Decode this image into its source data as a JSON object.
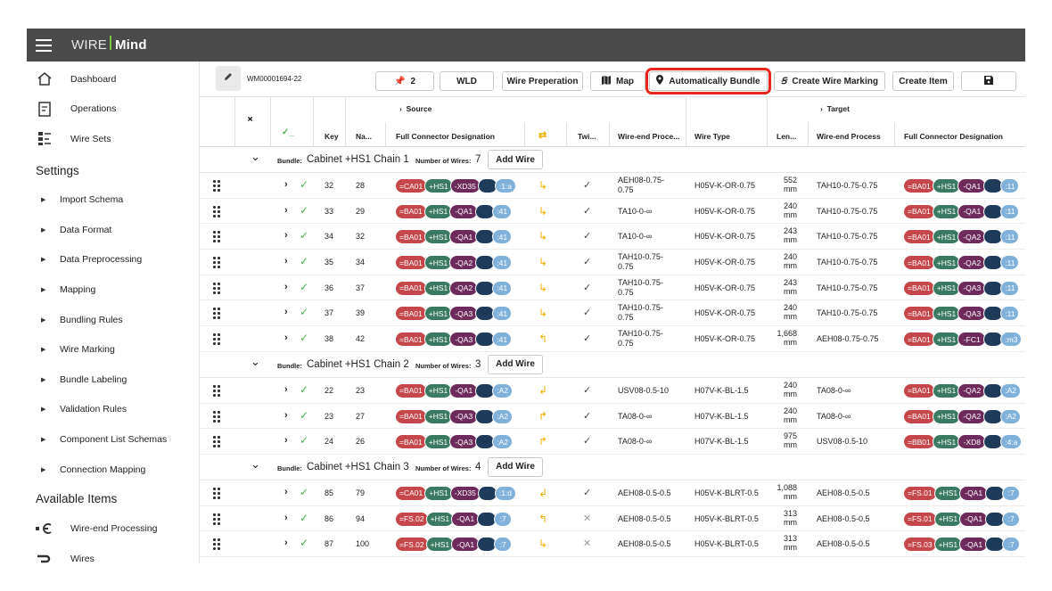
{
  "app": {
    "brand_part1": "WIRE",
    "brand_part2": "Mind"
  },
  "sidebar": {
    "main_items": [
      {
        "label": "Dashboard",
        "icon": "home-icon"
      },
      {
        "label": "Operations",
        "icon": "document-icon"
      },
      {
        "label": "Wire Sets",
        "icon": "wire-sets-icon"
      }
    ],
    "settings_title": "Settings",
    "settings_items": [
      "Import Schema",
      "Data Format",
      "Data Preprocessing",
      "Mapping",
      "Bundling Rules",
      "Wire Marking",
      "Bundle Labeling",
      "Validation Rules",
      "Component List Schemas",
      "Connection Mapping"
    ],
    "available_title": "Available Items",
    "available_items": [
      {
        "label": "Wire-end Processing",
        "icon": "wire-end-icon"
      },
      {
        "label": "Wires",
        "icon": "wire-icon"
      }
    ]
  },
  "toolbar": {
    "wire_marking_id": "WM00001694-22",
    "pin_count": "2",
    "wld": "WLD",
    "wire_prep": "Wire Preperation",
    "map": "Map",
    "auto_bundle": "Automatically Bundle",
    "create_marking": "Create Wire Marking",
    "create_item": "Create Item"
  },
  "table": {
    "source_label": "Source",
    "target_label": "Target",
    "headers": {
      "check": "✓_",
      "key": "Key",
      "name": "Na...",
      "src_connector": "Full Connector Designation",
      "twist": "Twi...",
      "src_process": "Wire-end Proce...",
      "wire_type": "Wire Type",
      "length": "Len...",
      "tgt_process": "Wire-end Process",
      "tgt_connector": "Full Connector Designation"
    },
    "bundle_label": "Bundle:",
    "wires_label": "Number of Wires:",
    "add_wire": "Add Wire",
    "length_unit": "mm",
    "groups": [
      {
        "name": "Cabinet +HS1 Chain 1",
        "count": "7",
        "rows": [
          {
            "key": "32",
            "name": "28",
            "src": [
              "=CA01",
              "+HS1",
              "-XD35",
              "",
              ":1:a"
            ],
            "arrow": "↳",
            "twisted": true,
            "proc": [
              "AEH08-0.75-",
              "0.75"
            ],
            "type": "H05V-K-OR-0.75",
            "len": "552",
            "tproc": "TAH10-0.75-0.75",
            "tgt": [
              "=BA01",
              "+HS1",
              "-QA1",
              "",
              ":11"
            ]
          },
          {
            "key": "33",
            "name": "29",
            "src": [
              "=BA01",
              "+HS1",
              "-QA1",
              "",
              ":41"
            ],
            "arrow": "↳",
            "twisted": true,
            "proc": [
              "TA10-0-∞",
              ""
            ],
            "type": "H05V-K-OR-0.75",
            "len": "240",
            "tproc": "TAH10-0.75-0.75",
            "tgt": [
              "=BA01",
              "+HS1",
              "-QA1",
              "",
              ":11"
            ]
          },
          {
            "key": "34",
            "name": "32",
            "src": [
              "=BA01",
              "+HS1",
              "-QA1",
              "",
              ":41"
            ],
            "arrow": "↳",
            "twisted": true,
            "proc": [
              "TA10-0-∞",
              ""
            ],
            "type": "H05V-K-OR-0.75",
            "len": "243",
            "tproc": "TAH10-0.75-0.75",
            "tgt": [
              "=BA01",
              "+HS1",
              "-QA2",
              "",
              ":11"
            ]
          },
          {
            "key": "35",
            "name": "34",
            "src": [
              "=BA01",
              "+HS1",
              "-QA2",
              "",
              ":41"
            ],
            "arrow": "↳",
            "twisted": true,
            "proc": [
              "TAH10-0.75-",
              "0.75"
            ],
            "type": "H05V-K-OR-0.75",
            "len": "240",
            "tproc": "TAH10-0.75-0.75",
            "tgt": [
              "=BA01",
              "+HS1",
              "-QA2",
              "",
              ":11"
            ]
          },
          {
            "key": "36",
            "name": "37",
            "src": [
              "=BA01",
              "+HS1",
              "-QA2",
              "",
              ":41"
            ],
            "arrow": "↳",
            "twisted": true,
            "proc": [
              "TAH10-0.75-",
              "0.75"
            ],
            "type": "H05V-K-OR-0.75",
            "len": "243",
            "tproc": "TAH10-0.75-0.75",
            "tgt": [
              "=BA01",
              "+HS1",
              "-QA3",
              "",
              ":11"
            ]
          },
          {
            "key": "37",
            "name": "39",
            "src": [
              "=BA01",
              "+HS1",
              "-QA3",
              "",
              ":41"
            ],
            "arrow": "↳",
            "twisted": true,
            "proc": [
              "TAH10-0.75-",
              "0.75"
            ],
            "type": "H05V-K-OR-0.75",
            "len": "240",
            "tproc": "TAH10-0.75-0.75",
            "tgt": [
              "=BA01",
              "+HS1",
              "-QA3",
              "",
              ":11"
            ]
          },
          {
            "key": "38",
            "name": "42",
            "src": [
              "=BA01",
              "+HS1",
              "-QA3",
              "",
              ":41"
            ],
            "arrow": "↰",
            "twisted": true,
            "proc": [
              "TAH10-0.75-",
              "0.75"
            ],
            "type": "H05V-K-OR-0.75",
            "len": "1,668",
            "tproc": "AEH08-0.75-0.75",
            "tgt": [
              "=BA01",
              "+HS1",
              "-FC1",
              "",
              ":m3"
            ]
          }
        ]
      },
      {
        "name": "Cabinet +HS1 Chain 2",
        "count": "3",
        "rows": [
          {
            "key": "22",
            "name": "23",
            "src": [
              "=BA01",
              "+HS1",
              "-QA1",
              "",
              ":A2"
            ],
            "arrow": "↲",
            "twisted": true,
            "proc": [
              "USV08-0.5-10",
              ""
            ],
            "type": "H07V-K-BL-1.5",
            "len": "240",
            "tproc": "TA08-0-∞",
            "tgt": [
              "=BA01",
              "+HS1",
              "-QA2",
              "",
              ":A2"
            ]
          },
          {
            "key": "23",
            "name": "27",
            "src": [
              "=BA01",
              "+HS1",
              "-QA3",
              "",
              ":A2"
            ],
            "arrow": "↱",
            "twisted": true,
            "proc": [
              "TA08-0-∞",
              ""
            ],
            "type": "H07V-K-BL-1.5",
            "len": "240",
            "tproc": "TA08-0-∞",
            "tgt": [
              "=BA01",
              "+HS1",
              "-QA2",
              "",
              ":A2"
            ]
          },
          {
            "key": "24",
            "name": "26",
            "src": [
              "=BA01",
              "+HS1",
              "-QA3",
              "",
              ":A2"
            ],
            "arrow": "↱",
            "twisted": true,
            "proc": [
              "TA08-0-∞",
              ""
            ],
            "type": "H07V-K-BL-1.5",
            "len": "975",
            "tproc": "USV08-0.5-10",
            "tgt": [
              "=BB01",
              "+HS1",
              "-XD8",
              "",
              ":4:a"
            ]
          }
        ]
      },
      {
        "name": "Cabinet +HS1 Chain 3",
        "count": "4",
        "rows": [
          {
            "key": "85",
            "name": "79",
            "src": [
              "=CA01",
              "+HS1",
              "-XD35",
              "",
              ":1:d"
            ],
            "arrow": "↲",
            "twisted": true,
            "proc": [
              "AEH08-0.5-0.5",
              ""
            ],
            "type": "H05V-K-BLRT-0.5",
            "len": "1,088",
            "tproc": "AEH08-0.5-0.5",
            "tgt": [
              "=FS.01",
              "+HS1",
              "-QA1",
              "",
              ":7"
            ]
          },
          {
            "key": "86",
            "name": "94",
            "src": [
              "=FS.02",
              "+HS1",
              "-QA1",
              "",
              ":7"
            ],
            "arrow": "↰",
            "twisted": false,
            "proc": [
              "AEH08-0.5-0.5",
              ""
            ],
            "type": "H05V-K-BLRT-0.5",
            "len": "313",
            "tproc": "AEH08-0.5-0.5",
            "tgt": [
              "=FS.01",
              "+HS1",
              "-QA1",
              "",
              ":7"
            ]
          },
          {
            "key": "87",
            "name": "100",
            "src": [
              "=FS.02",
              "+HS1",
              "-QA1",
              "",
              ":7"
            ],
            "arrow": "↳",
            "twisted": false,
            "proc": [
              "AEH08-0.5-0.5",
              ""
            ],
            "type": "H05V-K-BLRT-0.5",
            "len": "313",
            "tproc": "AEH08-0.5-0.5",
            "tgt": [
              "=FS.03",
              "+HS1",
              "-QA1",
              "",
              ":7"
            ]
          }
        ]
      }
    ]
  },
  "colors": {
    "appbar": "#4b4b4b",
    "accent_green": "#7cc443",
    "highlight_red": "#e8261c",
    "pill_red": "#c5474a",
    "pill_green": "#3a7a62",
    "pill_purple": "#6e2a5a",
    "pill_navy": "#1f3b5c",
    "pill_blue": "#7fb1da",
    "arrow_yellow": "#f0b000"
  }
}
